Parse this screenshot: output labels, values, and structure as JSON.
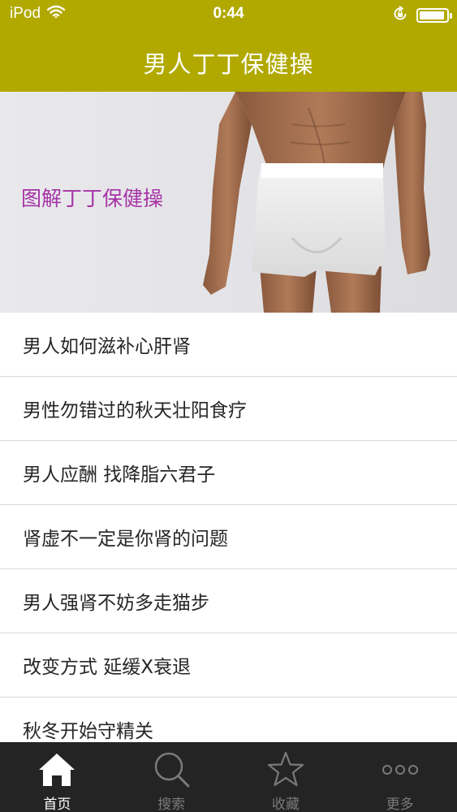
{
  "status_bar": {
    "carrier": "iPod",
    "time": "0:44",
    "battery_level": 0.95
  },
  "nav": {
    "title": "男人丁丁保健操"
  },
  "banner": {
    "label": "图解丁丁保健操",
    "label_color": "#a633a6"
  },
  "articles": [
    "男人如何滋补心肝肾",
    "男性勿错过的秋天壮阳食疗",
    "男人应酬 找降脂六君子",
    "肾虚不一定是你肾的问题",
    "男人强肾不妨多走猫步",
    "改变方式 延缓X衰退",
    "秋冬开始守精关"
  ],
  "tabs": [
    {
      "label": "首页",
      "icon": "home-icon",
      "active": true
    },
    {
      "label": "搜索",
      "icon": "search-icon",
      "active": false
    },
    {
      "label": "收藏",
      "icon": "star-icon",
      "active": false
    },
    {
      "label": "更多",
      "icon": "more-icon",
      "active": false
    }
  ],
  "colors": {
    "header": "#b1a900",
    "tabbar": "#242424",
    "tab_active": "#ffffff",
    "tab_inactive": "#7a7a7a"
  }
}
